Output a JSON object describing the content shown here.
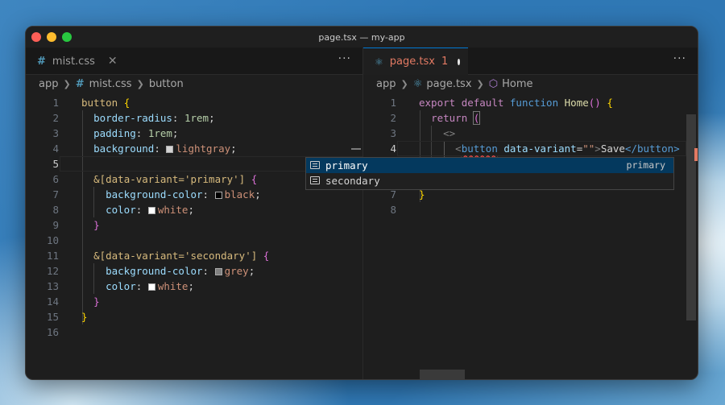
{
  "window": {
    "title": "page.tsx — my-app"
  },
  "left": {
    "tab": {
      "icon": "#",
      "label": "mist.css",
      "close": "✕"
    },
    "more": "···",
    "breadcrumb": {
      "root": "app",
      "icon": "#",
      "file": "mist.css",
      "symbol": "button"
    }
  },
  "right": {
    "tab": {
      "label": "page.tsx",
      "problems": "1"
    },
    "more": "···",
    "breadcrumb": {
      "root": "app",
      "file": "page.tsx",
      "symbol": "Home"
    }
  },
  "left_line_numbers": [
    "1",
    "2",
    "3",
    "4",
    "5",
    "6",
    "7",
    "8",
    "9",
    "10",
    "11",
    "12",
    "13",
    "14",
    "15",
    "16"
  ],
  "right_line_numbers": [
    "1",
    "2",
    "3",
    "4",
    "5",
    "6",
    "7",
    "8"
  ],
  "css_code": {
    "l1_sel": "button",
    "l2_prop": "border-radius",
    "l2_val": "1rem",
    "l3_prop": "padding",
    "l3_val": "1rem",
    "l4_prop": "background",
    "l4_val": "lightgray",
    "l6_sel": "&[data-variant='primary']",
    "l7_prop": "background-color",
    "l7_val": "black",
    "l8_prop": "color",
    "l8_val": "white",
    "l11_sel": "&[data-variant='secondary']",
    "l12_prop": "background-color",
    "l12_val": "grey",
    "l13_prop": "color",
    "l13_val": "white"
  },
  "tsx_code": {
    "l1_export": "export",
    "l1_default": "default",
    "l1_function": "function",
    "l1_name": "Home",
    "l2_return": "return",
    "l3_frag": "<>",
    "l4_tag": "button",
    "l4_attr": "data-variant",
    "l4_val": "\"\"",
    "l4_text": "Save",
    "l4_close": "</button>"
  },
  "suggestions": [
    {
      "label": "primary",
      "detail": "primary"
    },
    {
      "label": "secondary",
      "detail": ""
    }
  ],
  "colors": {
    "lightgray": "#d3d3d3",
    "black": "#000000",
    "white": "#ffffff",
    "grey": "#808080",
    "accent": "#0078d4",
    "modified": "#e37a63"
  }
}
